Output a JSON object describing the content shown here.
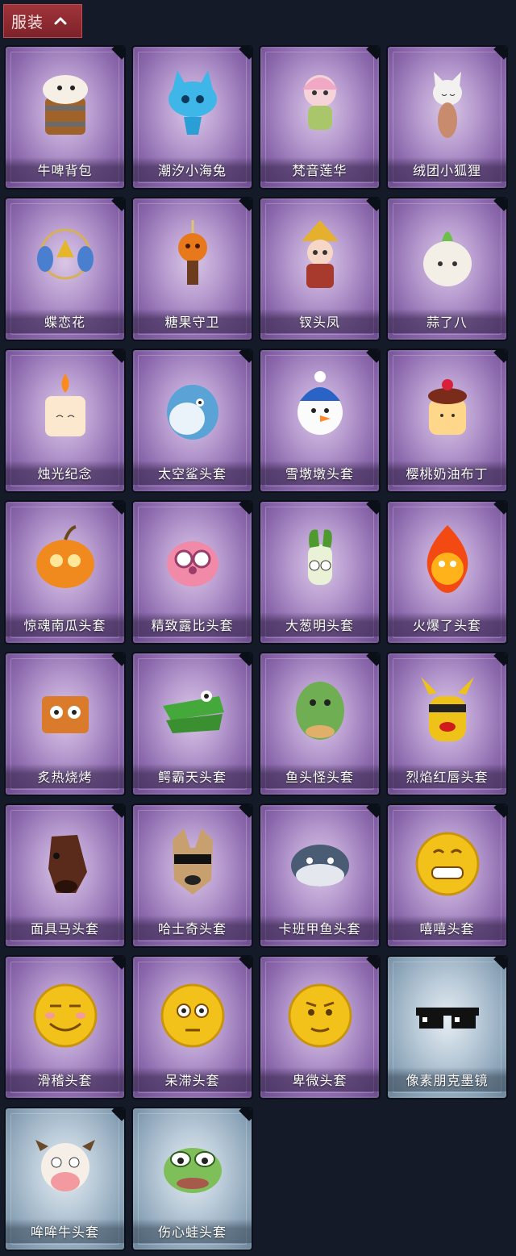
{
  "header": {
    "title": "服装"
  },
  "items": [
    {
      "label": "牛啤背包",
      "icon": "cow-beer-backpack-icon",
      "rarity": "purple"
    },
    {
      "label": "潮汐小海兔",
      "icon": "sea-bunny-icon",
      "rarity": "purple"
    },
    {
      "label": "梵音莲华",
      "icon": "lotus-doll-icon",
      "rarity": "purple"
    },
    {
      "label": "绒团小狐狸",
      "icon": "fluffy-fox-icon",
      "rarity": "purple"
    },
    {
      "label": "蝶恋花",
      "icon": "butterfly-bell-icon",
      "rarity": "purple"
    },
    {
      "label": "糖果守卫",
      "icon": "candy-guard-icon",
      "rarity": "purple"
    },
    {
      "label": "钗头凤",
      "icon": "phoenix-hairpin-doll-icon",
      "rarity": "purple"
    },
    {
      "label": "蒜了八",
      "icon": "garlic-icon",
      "rarity": "purple"
    },
    {
      "label": "烛光纪念",
      "icon": "candle-icon",
      "rarity": "purple"
    },
    {
      "label": "太空鲨头套",
      "icon": "space-shark-head-icon",
      "rarity": "purple"
    },
    {
      "label": "雪墩墩头套",
      "icon": "snowman-head-icon",
      "rarity": "purple"
    },
    {
      "label": "樱桃奶油布丁",
      "icon": "pudding-icon",
      "rarity": "purple"
    },
    {
      "label": "惊魂南瓜头套",
      "icon": "pumpkin-head-icon",
      "rarity": "purple"
    },
    {
      "label": "精致露比头套",
      "icon": "pink-beaver-head-icon",
      "rarity": "purple"
    },
    {
      "label": "大葱明头套",
      "icon": "green-onion-head-icon",
      "rarity": "purple"
    },
    {
      "label": "火爆了头套",
      "icon": "fire-head-icon",
      "rarity": "purple"
    },
    {
      "label": "炙热烧烤",
      "icon": "bbq-meat-icon",
      "rarity": "purple"
    },
    {
      "label": "鳄霸天头套",
      "icon": "crocodile-head-icon",
      "rarity": "purple"
    },
    {
      "label": "鱼头怪头套",
      "icon": "fish-head-icon",
      "rarity": "purple"
    },
    {
      "label": "烈焰红唇头套",
      "icon": "yellow-mascot-head-icon",
      "rarity": "purple"
    },
    {
      "label": "面具马头套",
      "icon": "horse-head-icon",
      "rarity": "purple"
    },
    {
      "label": "哈士奇头套",
      "icon": "husky-head-icon",
      "rarity": "purple"
    },
    {
      "label": "卡班甲鱼头套",
      "icon": "fish-round-head-icon",
      "rarity": "purple"
    },
    {
      "label": "嘻嘻头套",
      "icon": "grin-emoji-head-icon",
      "rarity": "purple"
    },
    {
      "label": "滑稽头套",
      "icon": "funny-emoji-head-icon",
      "rarity": "purple"
    },
    {
      "label": "呆滞头套",
      "icon": "stunned-emoji-head-icon",
      "rarity": "purple"
    },
    {
      "label": "卑微头套",
      "icon": "humble-emoji-head-icon",
      "rarity": "purple"
    },
    {
      "label": "像素朋克墨镜",
      "icon": "pixel-sunglasses-icon",
      "rarity": "blue"
    },
    {
      "label": "哞哞牛头套",
      "icon": "cow-head-icon",
      "rarity": "blue"
    },
    {
      "label": "伤心蛙头套",
      "icon": "sad-frog-head-icon",
      "rarity": "blue"
    }
  ]
}
